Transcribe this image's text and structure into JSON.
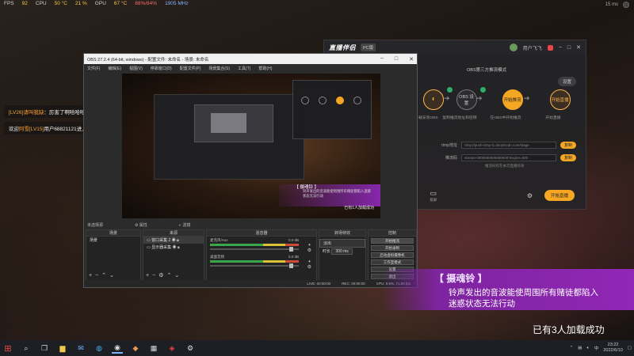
{
  "perf": {
    "fps_label": "FPS",
    "fps_value": "92",
    "cpu_label": "CPU",
    "cpu_temp": "50 °C",
    "cpu_load": "21 %",
    "gpu_label": "GPU",
    "gpu_temp": "67 °C",
    "gpu_load": "88%/84%",
    "gpu_clock": "1905 MHz"
  },
  "tray_top": {
    "text": "15 ms"
  },
  "chat": [
    {
      "level": "[LV26]",
      "user": "请叫我缺",
      "message": "：厉害了啊哈哈哈"
    },
    {
      "prefix": "欢迎",
      "user": "阿雪",
      "level": "[LV15]",
      "message": "用户68821121进入直播间"
    }
  ],
  "live_app": {
    "logo": "直播伴侣",
    "tag": "PC版",
    "top_user": "用户飞飞",
    "mode_label": "OBS第三方推流模式",
    "settings_btn": "设置",
    "steps": [
      {
        "label": "下载OBS",
        "caption": "下载安装OBS"
      },
      {
        "label": "OBS 设置",
        "caption": "复制推流地址和密钥"
      },
      {
        "label": "开始推流",
        "caption": "在OBS中开始推流"
      },
      {
        "label": "开始直播",
        "caption": "开始直播"
      }
    ],
    "rtmp_label": "rtmp地址",
    "rtmp_value": "rtmp://push-rtmp-l1.douyincdn.com/stage",
    "key_label": "推流码",
    "key_value": "stream-0000000000000000?expire=000",
    "copy_label": "复制",
    "hint": "推流码仅在本次直播有效",
    "bottom_buttons": [
      "礼物",
      "截屏",
      "连线",
      "PK",
      "音乐",
      "投屏"
    ],
    "start_btn": "开始直播"
  },
  "obs": {
    "title": "OBS 27.2.4 (64-bit, windows) - 配置文件: 未命名 - 场景: 未命名",
    "menu": [
      "文件(F)",
      "编辑(E)",
      "视图(V)",
      "停靠窗口(D)",
      "配置文件(P)",
      "场景集合(S)",
      "工具(T)",
      "帮助(H)"
    ],
    "no_source": "未选择源",
    "props_btn": "属性",
    "filters_btn": "滤镜",
    "docks": {
      "scenes": "场景",
      "sources": "来源",
      "mixer": "混音器",
      "transitions": "转场特效",
      "controls": "控制"
    },
    "scene_items": [
      "场景"
    ],
    "source_items": [
      "窗口采集 2",
      "显示器采集"
    ],
    "mixer": [
      {
        "name": "麦克风/Aux",
        "db": "0.0 dB"
      },
      {
        "name": "桌面音频",
        "db": "0.0 dB"
      }
    ],
    "transition": {
      "type": "淡出",
      "duration_label": "时长",
      "duration": "300 ms"
    },
    "controls": [
      "开始推流",
      "开始录制",
      "启动虚拟摄像机",
      "工作室模式",
      "设置",
      "退出"
    ],
    "status": {
      "live": "LIVE: 00:00:00",
      "rec": "REC: 00:00:00",
      "cpu": "CPU: 0.6%, 71.00 fps"
    },
    "preview": {
      "banner_title": "【 摄魂铃 】",
      "banner_text": "铃声发出的音波能使周围所有赌徒都陷入迷惑状态无法行动",
      "loaded": "已有1人加载成功"
    }
  },
  "banner": {
    "title": "【 摄魂铃 】",
    "line1": "铃声发出的音波能使周围所有赌徒都陷入",
    "line2": "迷惑状态无法行动"
  },
  "loaded": "已有3人加载成功",
  "taskbar": {
    "time": "23:22",
    "date": "2022/6/10",
    "ime": "中"
  }
}
